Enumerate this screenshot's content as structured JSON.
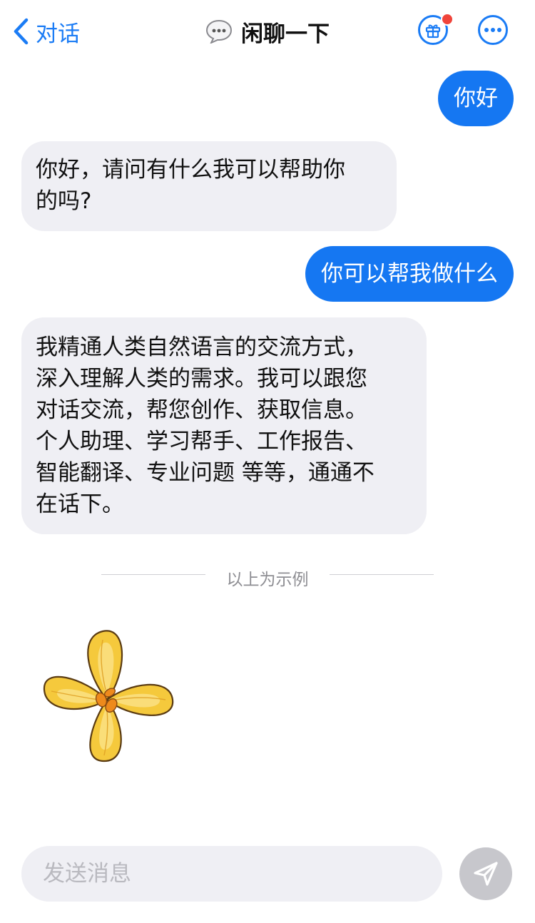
{
  "nav": {
    "back_label": "对话",
    "title": "闲聊一下",
    "title_icon": "speech-bubble-icon",
    "gift_icon": "gift-icon",
    "more_icon": "more-icon",
    "accent_color": "#1b7cf5",
    "badge_color": "#f0443a"
  },
  "messages": [
    {
      "role": "user",
      "text": "你好"
    },
    {
      "role": "assistant",
      "lines": [
        "你好，请问有什么我可以帮助你",
        "的吗?"
      ]
    },
    {
      "role": "user",
      "text": "你可以帮我做什么"
    },
    {
      "role": "assistant",
      "lines": [
        "我精通人类自然语言的交流方式，",
        "深入理解人类的需求。我可以跟您",
        "对话交流，帮您创作、获取信息。",
        "个人助理、学习帮手、工作报告、",
        "智能翻译、专业问题 等等，通通不",
        "在话下。"
      ]
    }
  ],
  "divider_text": "以上为示例",
  "sticker": "yellow-flower-sticker",
  "composer": {
    "placeholder": "发送消息",
    "send_icon": "send-icon"
  },
  "colors": {
    "user_bubble": "#1577f2",
    "bot_bubble": "#efeff4",
    "send_button": "#c7c7cc"
  }
}
